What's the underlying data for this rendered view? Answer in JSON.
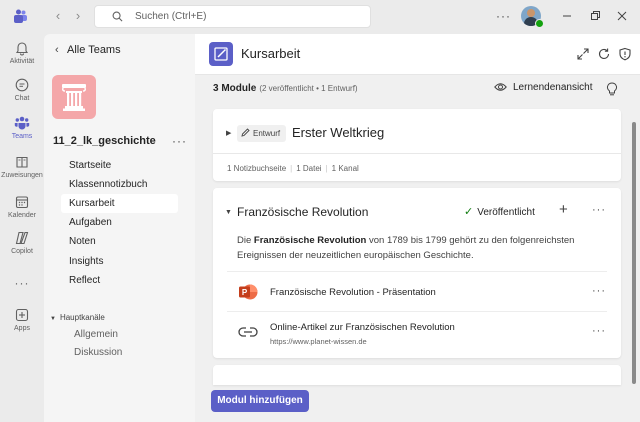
{
  "titlebar": {
    "search_placeholder": "Suchen (Ctrl+E)"
  },
  "rail": {
    "items": [
      {
        "label": "Aktivität",
        "icon": "bell-icon"
      },
      {
        "label": "Chat",
        "icon": "chat-icon"
      },
      {
        "label": "Teams",
        "icon": "teams-icon",
        "active": true
      },
      {
        "label": "Zuweisungen",
        "icon": "assignments-icon"
      },
      {
        "label": "Kalender",
        "icon": "calendar-icon"
      },
      {
        "label": "Copilot",
        "icon": "copilot-icon"
      },
      {
        "label": "Apps",
        "icon": "apps-icon"
      }
    ]
  },
  "team_panel": {
    "back_label": "Alle Teams",
    "team_name": "11_2_lk_geschichte",
    "nav": [
      "Startseite",
      "Klassennotizbuch",
      "Kursarbeit",
      "Aufgaben",
      "Noten",
      "Insights",
      "Reflect"
    ],
    "active_nav": "Kursarbeit",
    "channels_header": "Hauptkanäle",
    "channels": [
      "Allgemein",
      "Diskussion"
    ]
  },
  "header": {
    "title": "Kursarbeit"
  },
  "content": {
    "modules_count": "3 Module",
    "modules_sub": "(2 veröffentlicht • 1 Entwurf)",
    "learner_view": "Lernendenansicht",
    "module1": {
      "badge": "Entwurf",
      "title": "Erster Weltkrieg",
      "meta": [
        "1 Notizbuchseite",
        "1 Datei",
        "1 Kanal"
      ]
    },
    "module2": {
      "title": "Französische Revolution",
      "status": "Veröffentlicht",
      "desc_pre": "Die ",
      "desc_bold": "Französische Revolution",
      "desc_post": " von 1789 bis 1799 gehört zu den folgenreichsten Ereignissen der neuzeitlichen europäischen Geschichte.",
      "resources": [
        {
          "title": "Französische Revolution - Präsentation",
          "icon": "powerpoint-icon"
        },
        {
          "title": "Online-Artikel zur Französischen Revolution",
          "url": "https://www.planet-wissen.de",
          "icon": "link-icon"
        }
      ]
    },
    "add_module": "Modul hinzufügen"
  },
  "colors": {
    "accent": "#5b5fc7",
    "published_check": "#107c10",
    "team_tile": "#f4a7a9"
  }
}
